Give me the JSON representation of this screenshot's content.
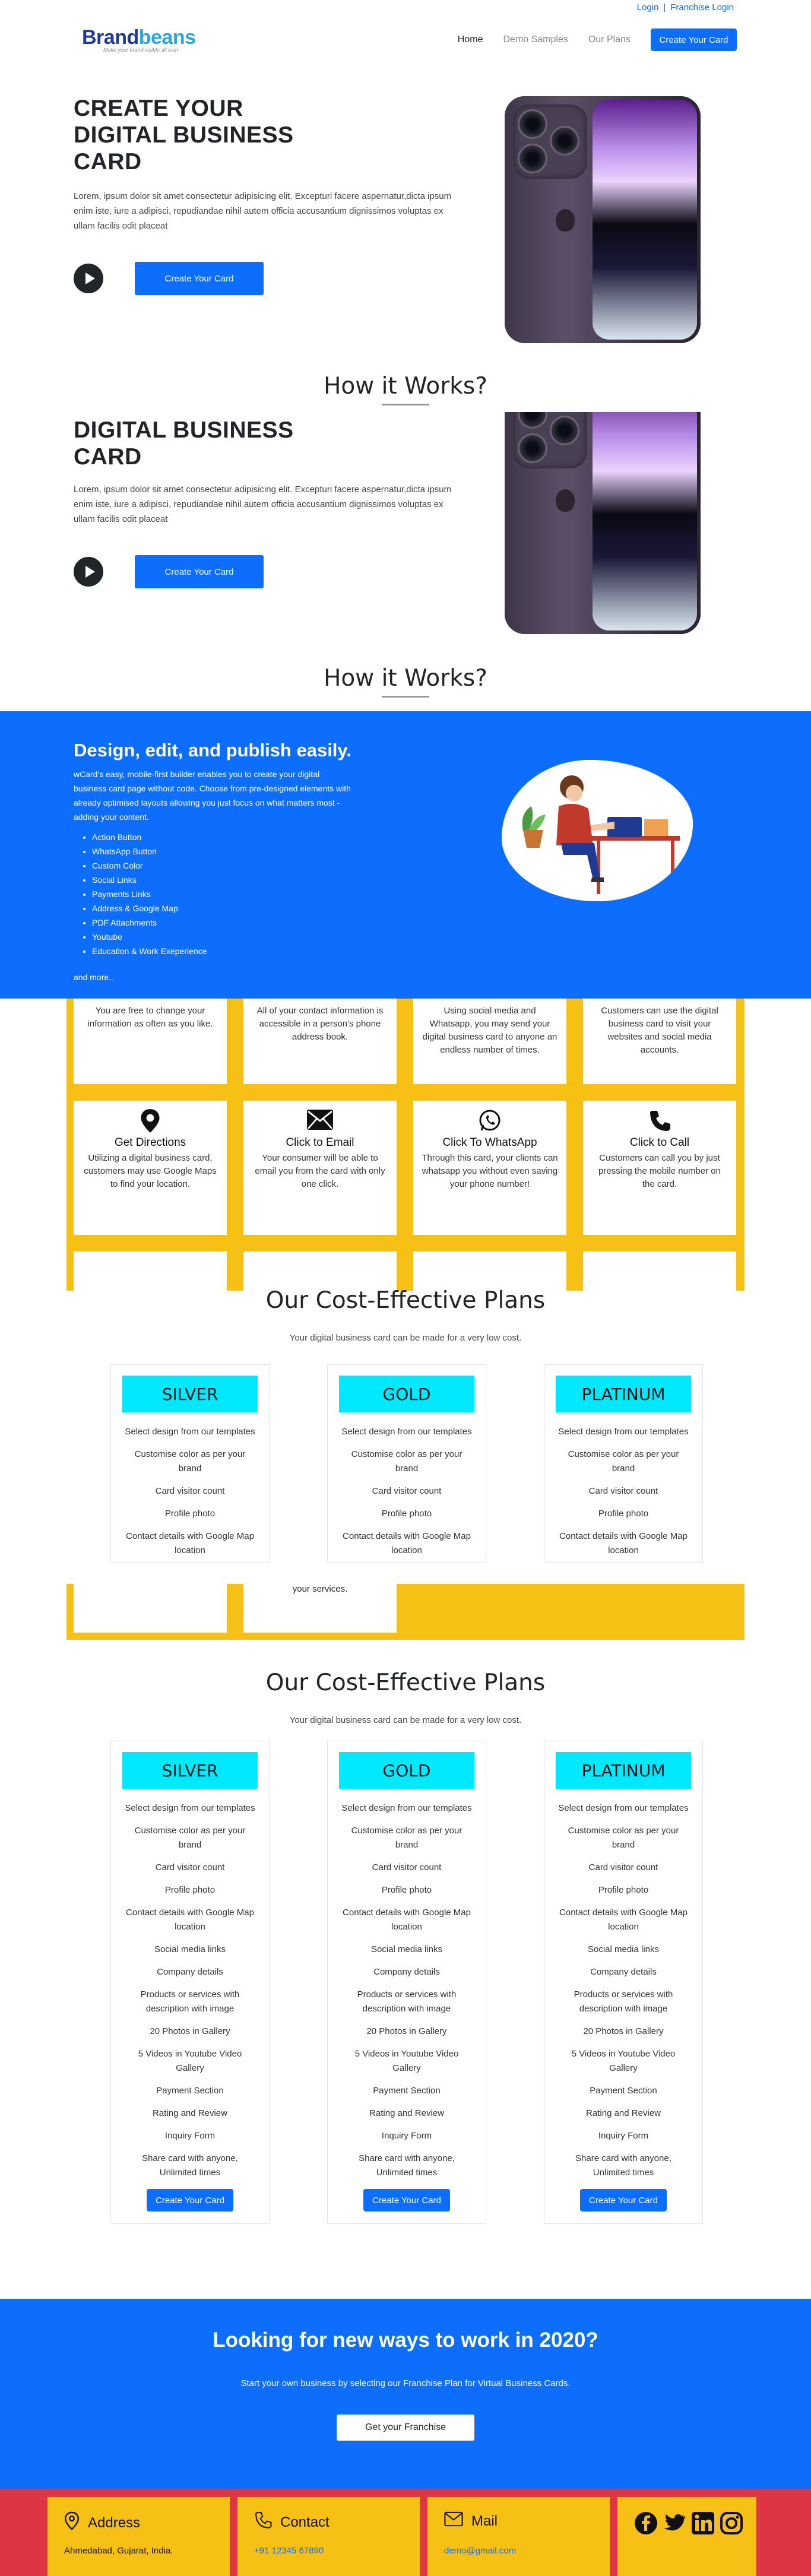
{
  "topbar": {
    "login": "Login",
    "separator": "|",
    "franchise_login": "Franchise Login"
  },
  "logo": {
    "brand_part1": "Brand",
    "brand_part2": "beans",
    "tagline": "Make your brand visible all over",
    "colors": {
      "part1": "#1f3a93",
      "part2": "#2aa6e0"
    }
  },
  "nav": {
    "items": [
      "Home",
      "Demo Samples",
      "Our Plans"
    ],
    "cta": "Create Your Card"
  },
  "hero": {
    "title": "CREATE YOUR DIGITAL BUSINESS CARD",
    "title_partial": "DIGITAL BUSINESS CARD",
    "text": "Lorem, ipsum dolor sit amet consectetur adipisicing elit. Excepturi facere aspernatur,dicta ipsum enim iste, iure a adipisci, repudiandae nihil autem officia accusantium dignissimos voluptas ex ullam facilis odit placeat",
    "play_icon": "play-icon",
    "cta": "Create Your Card"
  },
  "how_it_works": {
    "title": "How it Works?"
  },
  "design_block": {
    "title": "Design, edit, and publish easily.",
    "description": "wCard's easy, mobile-first builder enables you to create your digital business card page without code. Choose from pre-designed elements with already optimised layouts allowing you just focus on what matters most - adding your content.",
    "features": [
      "Action Button",
      "WhatsApp Button",
      "Custom Color",
      "Social Links",
      "Payments Links",
      "Address & Google Map",
      "PDF Attachments",
      "Youtube",
      "Education & Work Exeperience"
    ],
    "more": "and more..",
    "background": "#0d6efd"
  },
  "features_grid": {
    "row1": [
      {
        "desc": "You are free to change your information as often as you like."
      },
      {
        "desc": "All of your contact information is accessible in a person's phone address book."
      },
      {
        "desc": "Using social media and Whatsapp, you may send your digital business card to anyone an endless number of times."
      },
      {
        "desc": "Customers can use the digital business card to visit your websites and social media accounts."
      }
    ],
    "row2": [
      {
        "icon": "map-pin-icon",
        "title": "Get Directions",
        "desc": "Utilizing a digital business card, customers may use Google Maps to find your location."
      },
      {
        "icon": "envelope-icon",
        "title": "Click to Email",
        "desc": "Your consumer will be able to email you from the card with only one click."
      },
      {
        "icon": "whatsapp-icon",
        "title": "Click To WhatsApp",
        "desc": "Through this card, your clients can whatsapp you without even saving your phone number!"
      },
      {
        "icon": "phone-icon",
        "title": "Click to Call",
        "desc": "Customers can call you by just pressing the mobile number on the card."
      }
    ],
    "partial_text": "your services.",
    "background": "#f7c014"
  },
  "plans": {
    "title": "Our Cost-Effective Plans",
    "subtitle": "Your digital business card can be made for a very low cost.",
    "names": [
      "SILVER",
      "GOLD",
      "PLATINUM"
    ],
    "features": [
      "Select design from our templates",
      "Customise color as per your brand",
      "Card visitor count",
      "Profile photo",
      "Contact details with Google Map location",
      "Social media links",
      "Company details",
      "Products or services with description with image",
      "20 Photos in Gallery",
      "5 Videos in Youtube Video Gallery",
      "Payment Section",
      "Rating and Review",
      "Inquiry Form",
      "Share card with anyone, Unlimited times"
    ],
    "cta": "Create Your Card",
    "header_color": "#00e9ff"
  },
  "franchise": {
    "title": "Looking for new ways to work in 2020?",
    "subtitle": "Start your own business by selecting our Franchise Plan for Virtual Business Cards.",
    "cta": "Get your Franchise"
  },
  "footer": {
    "address": {
      "icon": "map-pin-icon",
      "label": "Address",
      "value": "Ahmedabad, Gujarat, India."
    },
    "contact": {
      "icon": "phone-icon",
      "label": "Contact",
      "value": "+91 12345 67890"
    },
    "mail": {
      "icon": "envelope-icon",
      "label": "Mail",
      "value": "demo@gmail.com"
    },
    "social_icons": [
      "facebook-icon",
      "twitter-icon",
      "linkedin-icon",
      "instagram-icon"
    ],
    "background": "#de3545"
  }
}
